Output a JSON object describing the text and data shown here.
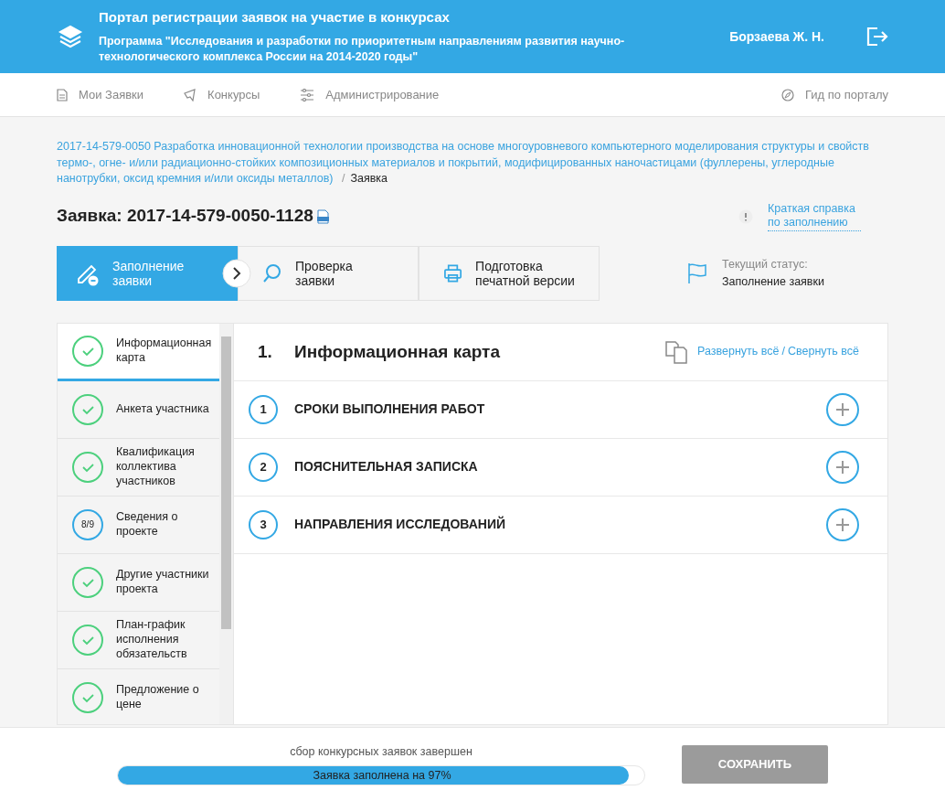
{
  "header": {
    "title": "Портал регистрации заявок на участие в конкурсах",
    "subtitle": "Программа \"Исследования и разработки по приоритетным направлениям развития научно-технологического комплекса России на 2014-2020 годы\"",
    "user": "Борзаева Ж. Н."
  },
  "nav": {
    "items": [
      {
        "label": "Мои Заявки"
      },
      {
        "label": "Конкурсы"
      },
      {
        "label": "Администрирование"
      }
    ],
    "guide": "Гид по порталу"
  },
  "breadcrumb": {
    "link": "2017-14-579-0050 Разработка инновационной технологии производства на основе многоуровневого компьютерного моделирования структуры и свойств термо-, огне- и/или радиационно-стойких композиционных материалов и покрытий, модифицированных наночастицами (фуллерены, углеродные нанотрубки, оксид кремния и/или оксиды металлов)",
    "separator": "/",
    "current": "Заявка"
  },
  "title": "Заявка: 2017-14-579-0050-1128",
  "help_link": "Краткая справка по заполнению",
  "steps": [
    {
      "label": "Заполнение заявки",
      "selected": true
    },
    {
      "label": "Проверка заявки",
      "selected": false
    },
    {
      "label": "Подготовка печатной версии",
      "selected": false
    }
  ],
  "status": {
    "label": "Текущий статус:",
    "value": "Заполнение заявки"
  },
  "sidebar": {
    "items": [
      {
        "label": "Информационная карта",
        "kind": "done",
        "selected": true
      },
      {
        "label": "Анкета участника",
        "kind": "done",
        "selected": false
      },
      {
        "label": "Квалификация коллектива участников",
        "kind": "done",
        "selected": false
      },
      {
        "label": "Сведения о проекте",
        "kind": "progress",
        "progress": "8/9",
        "selected": false
      },
      {
        "label": "Другие участники проекта",
        "kind": "done",
        "selected": false
      },
      {
        "label": "План-график исполнения обязательств",
        "kind": "done",
        "selected": false
      },
      {
        "label": "Предложение о цене",
        "kind": "done",
        "selected": false
      }
    ]
  },
  "section": {
    "number": "1.",
    "title": "Информационная карта",
    "expand_all": "Развернуть всё",
    "separator": "/",
    "collapse_all": "Свернуть всё",
    "items": [
      {
        "number": "1",
        "title": "СРОКИ ВЫПОЛНЕНИЯ РАБОТ",
        "expanded": false
      },
      {
        "number": "2",
        "title": "ПОЯСНИТЕЛЬНАЯ ЗАПИСКА",
        "expanded": false
      },
      {
        "number": "3",
        "title": "НАПРАВЛЕНИЯ ИССЛЕДОВАНИЙ",
        "expanded": false
      }
    ]
  },
  "footer": {
    "notice": "сбор конкурсных заявок завершен",
    "progress_label": "Заявка заполнена на 97%",
    "level": 0.97,
    "save": "СОХРАНИТЬ"
  }
}
